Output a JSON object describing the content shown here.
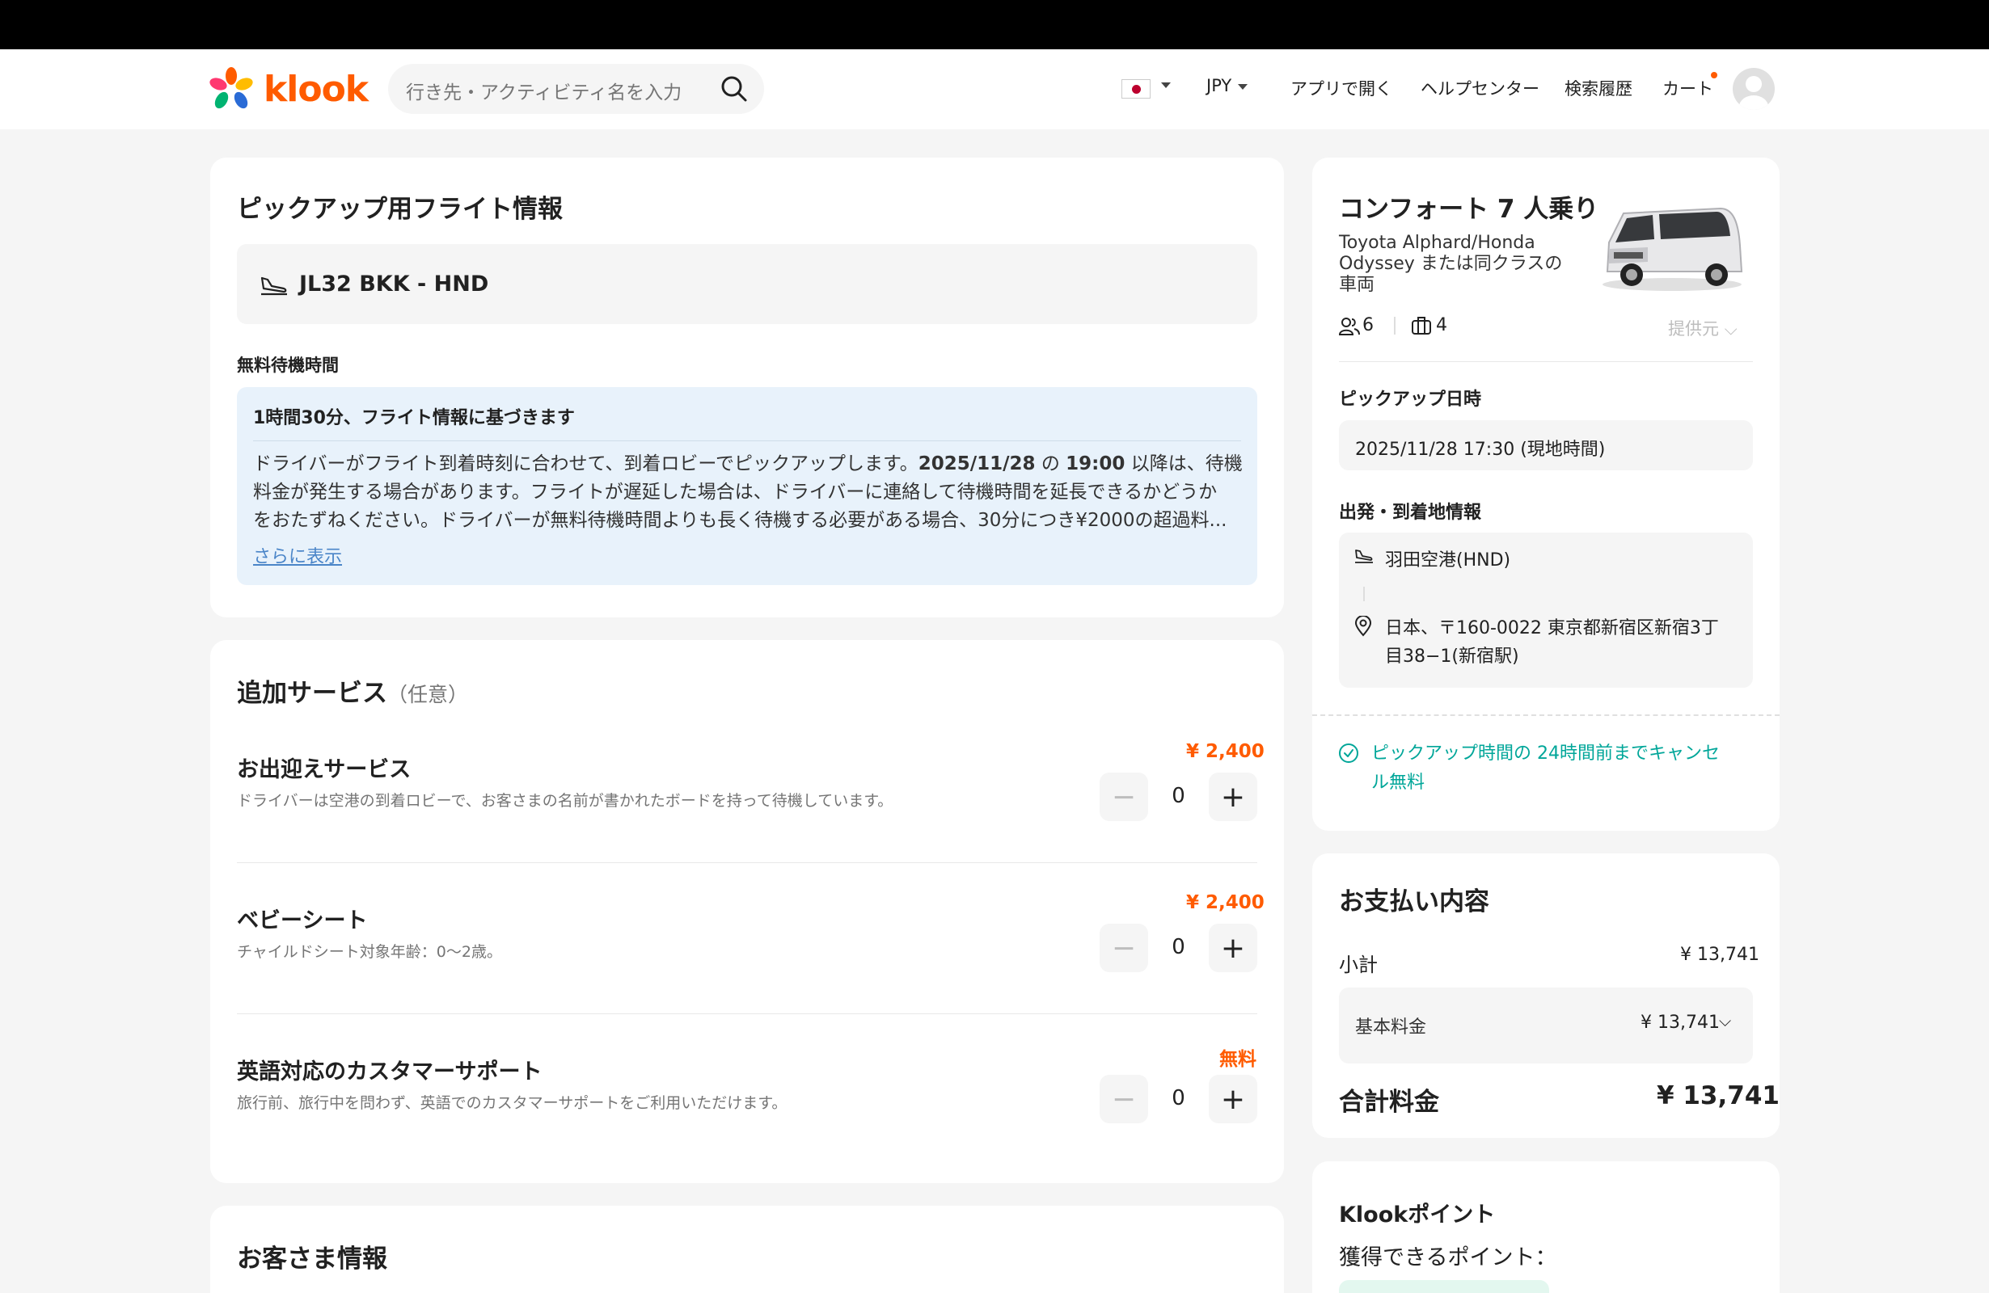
{
  "header": {
    "logo_text": "klook",
    "search_placeholder": "行き先・アクティビティ名を入力",
    "currency": "JPY",
    "nav": [
      "アプリで開く",
      "ヘルプセンター",
      "検索履歴",
      "カート"
    ]
  },
  "flight_card": {
    "title": "ピックアップ用フライト情報",
    "flight": "JL32 BKK - HND",
    "free_wait_label": "無料待機時間",
    "info_title": "1時間30分、フライト情報に基づきます",
    "info_line1_a": "ドライバーがフライト到着時刻に合わせて、到着ロビーでピックアップします。",
    "info_line1_date": "2025/11/28",
    "info_line1_b": " の ",
    "info_line1_time": "19:00",
    "info_line1_c": " 以降は、待機",
    "info_line2": "料金が発生する場合があります。フライトが遅延した場合は、ドライバーに連絡して待機時間を延長できるかどうか",
    "info_line3": "をおたずねください。ドライバーが無料待機時間よりも長く待機する必要がある場合、30分につき¥2000の超過料...",
    "show_more": "さらに表示"
  },
  "addons": {
    "title": "追加サービス",
    "optional": "（任意）",
    "items": [
      {
        "name": "お出迎えサービス",
        "desc": "ドライバーは空港の到着ロビーで、お客さまの名前が書かれたボードを持って待機しています。",
        "price": "¥ 2,400",
        "qty": "0"
      },
      {
        "name": "ベビーシート",
        "desc": "チャイルドシート対象年齢：0〜2歳。",
        "price": "¥ 2,400",
        "qty": "0"
      },
      {
        "name": "英語対応のカスタマーサポート",
        "desc": "旅行前、旅行中を問わず、英語でのカスタマーサポートをご利用いただけます。",
        "price": "無料",
        "qty": "0"
      }
    ]
  },
  "guest_card": {
    "title": "お客さま情報"
  },
  "vehicle": {
    "title": "コンフォート 7 人乗り",
    "desc_lines": [
      "Toyota Alphard/Honda",
      "Odyssey または同クラスの",
      "車両"
    ],
    "passengers": "6",
    "luggage": "4",
    "provider": "提供元",
    "pickup_label": "ピックアップ日時",
    "pickup_value": "2025/11/28 17:30 (現地時間)",
    "route_label": "出発・到着地情報",
    "origin": "羽田空港(HND)",
    "dest_line1": "日本、〒160-0022 東京都新宿区新宿3丁",
    "dest_line2": "目38−1(新宿駅)",
    "cancel_line1": "ピックアップ時間の 24時間前までキャンセ",
    "cancel_line2": "ル無料"
  },
  "payment": {
    "title": "お支払い内容",
    "subtotal_label": "小計",
    "subtotal_value": "¥ 13,741",
    "base_label": "基本料金",
    "base_value": "¥ 13,741",
    "total_label": "合計料金",
    "total_value": "¥ 13,741"
  },
  "points": {
    "title": "Klookポイント",
    "earn_label": "獲得できるポイント："
  },
  "colors": {
    "brand": "#ff5b00",
    "link": "#4a85c8",
    "success": "#00a699"
  }
}
